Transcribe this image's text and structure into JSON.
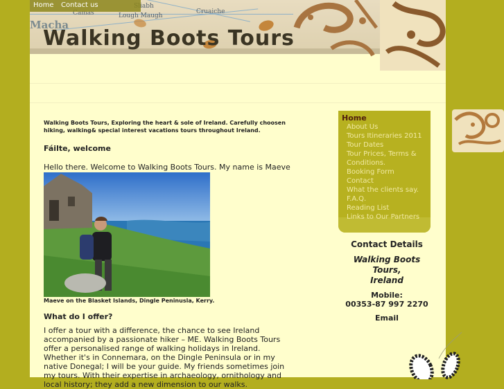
{
  "nav": {
    "home": "Home",
    "contact": "Contact us"
  },
  "header": {
    "title": "Walking Boots Tours",
    "map_labels": [
      "Sliabh",
      "Lough Maugh",
      "Macha",
      "Cruaiche",
      "Camas"
    ]
  },
  "intro": "Walking Boots Tours, Exploring the heart & sole of Ireland. Carefully choosen hiking, walking& special interest vacations tours throughout Ireland.",
  "welcome_heading": "Fáilte, welcome",
  "hello_text": "Hello there. Welcome to Walking Boots Tours. My name is Maeve Kelly.",
  "photo_caption": "Maeve on the Blasket Islands, Dingle Peninusla, Kerry.",
  "offer_heading": "What do I offer?",
  "offer_text": "I offer a tour with a difference, the chance to see Ireland accompanied by a passionate hiker – ME. Walking Boots Tours offer a personalised range of walking holidays in Ireland. Whether it's in Connemara, on the Dingle Peninsula or in my native Donegal; I will be your guide. My friends sometimes join my tours. With their expertise in archaeology, ornithology and local history; they add a new dimension to our walks.",
  "menu": [
    {
      "label": "Home",
      "active": true
    },
    {
      "label": "About Us"
    },
    {
      "label": "Tours Itineraries 2011"
    },
    {
      "label": "Tour Dates"
    },
    {
      "label": "Tour Prices, Terms &"
    },
    {
      "label": "Conditions."
    },
    {
      "label": "Booking Form"
    },
    {
      "label": "Contact"
    },
    {
      "label": "What the clients say."
    },
    {
      "label": "F.A.Q."
    },
    {
      "label": "Reading List"
    },
    {
      "label": "Links to Our Partners"
    }
  ],
  "contact": {
    "title": "Contact Details",
    "name_line1": "Walking Boots",
    "name_line2": "Tours,",
    "name_line3": "Ireland",
    "mobile_label": "Mobile:",
    "mobile_number": "00353-87 997 2270",
    "email_label": "Email"
  },
  "colors": {
    "background": "#b3ae1f",
    "page": "#fffecc",
    "menu": "#b7b120",
    "active_menu": "#4f1e0e"
  }
}
